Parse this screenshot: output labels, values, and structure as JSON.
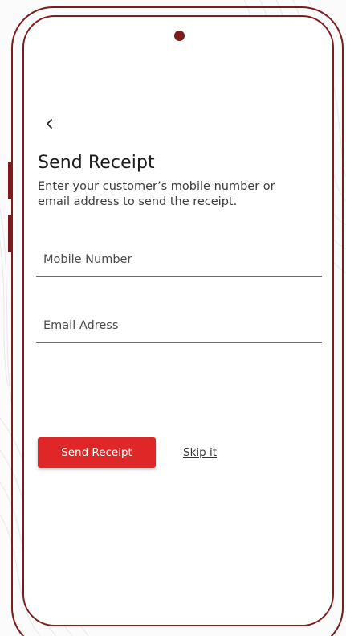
{
  "colors": {
    "frame": "#7d1c1c",
    "primary_button": "#e02727",
    "title_text": "#1c1c1c"
  },
  "screen": {
    "back_icon": "chevron-left-icon",
    "title": "Send Receipt",
    "subtitle": "Enter your customer’s mobile number or email address to send the receipt."
  },
  "form": {
    "mobile_placeholder": "Mobile Number",
    "mobile_value": "",
    "email_placeholder": "Email Adress",
    "email_value": ""
  },
  "actions": {
    "send_label": "Send Receipt",
    "skip_label": "Skip it"
  }
}
